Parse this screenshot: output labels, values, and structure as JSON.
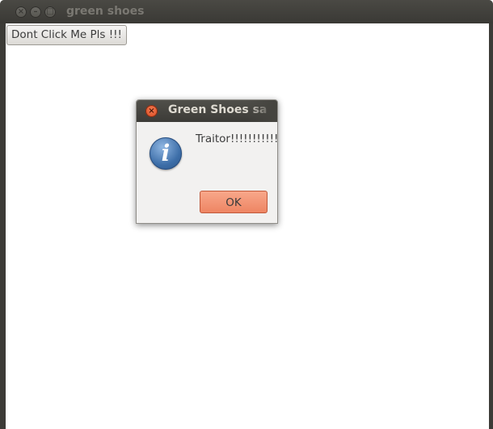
{
  "window": {
    "title": "green shoes",
    "controls": {
      "close": "×",
      "minimize": "–",
      "maximize": "□"
    }
  },
  "main": {
    "button_label": "Dont Click Me Pls !!!"
  },
  "dialog": {
    "title": "Green Shoes sa",
    "close_glyph": "×",
    "icon": "info-icon",
    "icon_glyph": "i",
    "message": "Traitor!!!!!!!!!!!",
    "ok_label": "OK"
  },
  "colors": {
    "titlebar": "#3c3b37",
    "dialog_close": "#e05a2f",
    "ok_button": "#f29574",
    "info_icon": "#3d6ea8"
  }
}
